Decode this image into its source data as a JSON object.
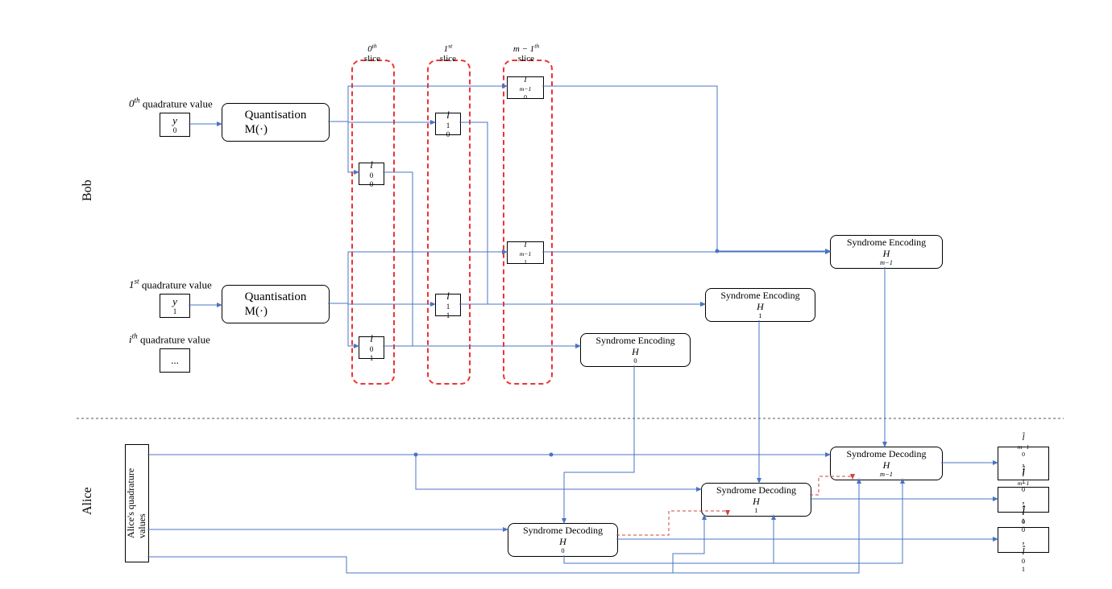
{
  "participants": {
    "bob": "Bob",
    "alice": "Alice"
  },
  "headers": {
    "q0": "<span class=\"it\">0<sup>th</sup></span> quadrature value",
    "q1": "<span class=\"it\">1<sup>st</sup></span> quadrature value",
    "qi": "<span class=\"it\">i<sup>th</sup></span> quadrature value"
  },
  "inputs": {
    "y0": "<span class=\"it\">y</span><sup>0</sup>",
    "y1": "<span class=\"it\">y</span><sup>1</sup>",
    "yi": "..."
  },
  "quant": "Quantisation<br>M(·)",
  "slices": {
    "s0": "<span class=\"it\">0<sup>th</sup></span><br>slice",
    "s1": "<span class=\"it\">1<sup>st</sup></span><br>slice",
    "sm": "<span class=\"it\">m − 1<sup>th</sup></span><br>slice"
  },
  "l": {
    "l00": "<span class=\"it\">l</span><sub>0</sub><sup>0</sup>",
    "l01": "<span class=\"it\">l</span><sub>1</sub><sup>0</sup>",
    "l0m": "<span class=\"it\">l</span><sub><span class=\"it\">m−1</span></sub><sup>0</sup>",
    "l10": "<span class=\"it\">l</span><sub>0</sub><sup>1</sup>",
    "l11": "<span class=\"it\">l</span><sub>1</sub><sup>1</sup>",
    "l1m": "<span class=\"it\">l</span><sub><span class=\"it\">m−1</span></sub><sup>1</sup>"
  },
  "enc": {
    "e0": "Syndrome Encoding<br><span class=\"it\">H</span><sub>0</sub>",
    "e1": "Syndrome Encoding<br><span class=\"it\">H</span><sub>1</sub>",
    "em": "Syndrome Encoding<br><span class=\"it\">H</span><sub><span class=\"it\">m−1</span></sub>"
  },
  "dec": {
    "d0": "Syndrome Decoding<br><span class=\"it\">H</span><sub>0</sub>",
    "d1": "Syndrome Decoding<br><span class=\"it\">H</span><sub>1</sub>",
    "dm": "Syndrome Decoding<br><span class=\"it\">H</span><sub><span class=\"it\">m−1</span></sub>"
  },
  "aliceData": "Alice's quadrature<br>values",
  "out": {
    "o0": "<span class=\"it\">l̂</span><sub>0</sub><sup>0</sup> , <span class=\"it\">l̂</span><sub>0</sub><sup>1</sup>",
    "o1": "<span class=\"it\">l̂</span><sub>1</sub><sup>0</sup> , <span class=\"it\">l̂</span><sub>1</sub><sup>1</sup>",
    "om": "<span class=\"it\">l̂</span><sub><span class=\"it\">m−1</span></sub><sup>0</sup>,<br><span class=\"it\">l̂</span><sub><span class=\"it\">m−1</span></sub><sup>1</sup>"
  }
}
